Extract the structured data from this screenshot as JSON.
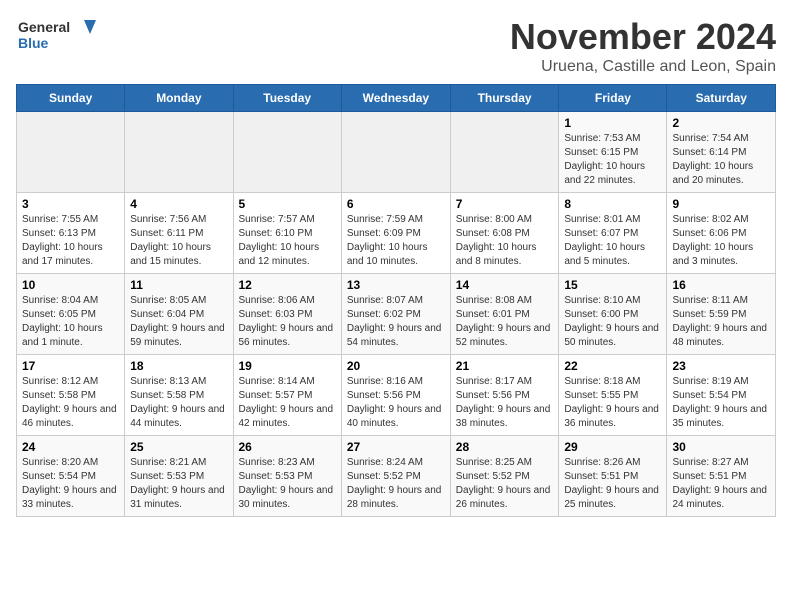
{
  "logo": {
    "line1": "General",
    "line2": "Blue"
  },
  "title": "November 2024",
  "subtitle": "Uruena, Castille and Leon, Spain",
  "weekdays": [
    "Sunday",
    "Monday",
    "Tuesday",
    "Wednesday",
    "Thursday",
    "Friday",
    "Saturday"
  ],
  "weeks": [
    [
      {
        "day": "",
        "info": ""
      },
      {
        "day": "",
        "info": ""
      },
      {
        "day": "",
        "info": ""
      },
      {
        "day": "",
        "info": ""
      },
      {
        "day": "",
        "info": ""
      },
      {
        "day": "1",
        "info": "Sunrise: 7:53 AM\nSunset: 6:15 PM\nDaylight: 10 hours and 22 minutes."
      },
      {
        "day": "2",
        "info": "Sunrise: 7:54 AM\nSunset: 6:14 PM\nDaylight: 10 hours and 20 minutes."
      }
    ],
    [
      {
        "day": "3",
        "info": "Sunrise: 7:55 AM\nSunset: 6:13 PM\nDaylight: 10 hours and 17 minutes."
      },
      {
        "day": "4",
        "info": "Sunrise: 7:56 AM\nSunset: 6:11 PM\nDaylight: 10 hours and 15 minutes."
      },
      {
        "day": "5",
        "info": "Sunrise: 7:57 AM\nSunset: 6:10 PM\nDaylight: 10 hours and 12 minutes."
      },
      {
        "day": "6",
        "info": "Sunrise: 7:59 AM\nSunset: 6:09 PM\nDaylight: 10 hours and 10 minutes."
      },
      {
        "day": "7",
        "info": "Sunrise: 8:00 AM\nSunset: 6:08 PM\nDaylight: 10 hours and 8 minutes."
      },
      {
        "day": "8",
        "info": "Sunrise: 8:01 AM\nSunset: 6:07 PM\nDaylight: 10 hours and 5 minutes."
      },
      {
        "day": "9",
        "info": "Sunrise: 8:02 AM\nSunset: 6:06 PM\nDaylight: 10 hours and 3 minutes."
      }
    ],
    [
      {
        "day": "10",
        "info": "Sunrise: 8:04 AM\nSunset: 6:05 PM\nDaylight: 10 hours and 1 minute."
      },
      {
        "day": "11",
        "info": "Sunrise: 8:05 AM\nSunset: 6:04 PM\nDaylight: 9 hours and 59 minutes."
      },
      {
        "day": "12",
        "info": "Sunrise: 8:06 AM\nSunset: 6:03 PM\nDaylight: 9 hours and 56 minutes."
      },
      {
        "day": "13",
        "info": "Sunrise: 8:07 AM\nSunset: 6:02 PM\nDaylight: 9 hours and 54 minutes."
      },
      {
        "day": "14",
        "info": "Sunrise: 8:08 AM\nSunset: 6:01 PM\nDaylight: 9 hours and 52 minutes."
      },
      {
        "day": "15",
        "info": "Sunrise: 8:10 AM\nSunset: 6:00 PM\nDaylight: 9 hours and 50 minutes."
      },
      {
        "day": "16",
        "info": "Sunrise: 8:11 AM\nSunset: 5:59 PM\nDaylight: 9 hours and 48 minutes."
      }
    ],
    [
      {
        "day": "17",
        "info": "Sunrise: 8:12 AM\nSunset: 5:58 PM\nDaylight: 9 hours and 46 minutes."
      },
      {
        "day": "18",
        "info": "Sunrise: 8:13 AM\nSunset: 5:58 PM\nDaylight: 9 hours and 44 minutes."
      },
      {
        "day": "19",
        "info": "Sunrise: 8:14 AM\nSunset: 5:57 PM\nDaylight: 9 hours and 42 minutes."
      },
      {
        "day": "20",
        "info": "Sunrise: 8:16 AM\nSunset: 5:56 PM\nDaylight: 9 hours and 40 minutes."
      },
      {
        "day": "21",
        "info": "Sunrise: 8:17 AM\nSunset: 5:56 PM\nDaylight: 9 hours and 38 minutes."
      },
      {
        "day": "22",
        "info": "Sunrise: 8:18 AM\nSunset: 5:55 PM\nDaylight: 9 hours and 36 minutes."
      },
      {
        "day": "23",
        "info": "Sunrise: 8:19 AM\nSunset: 5:54 PM\nDaylight: 9 hours and 35 minutes."
      }
    ],
    [
      {
        "day": "24",
        "info": "Sunrise: 8:20 AM\nSunset: 5:54 PM\nDaylight: 9 hours and 33 minutes."
      },
      {
        "day": "25",
        "info": "Sunrise: 8:21 AM\nSunset: 5:53 PM\nDaylight: 9 hours and 31 minutes."
      },
      {
        "day": "26",
        "info": "Sunrise: 8:23 AM\nSunset: 5:53 PM\nDaylight: 9 hours and 30 minutes."
      },
      {
        "day": "27",
        "info": "Sunrise: 8:24 AM\nSunset: 5:52 PM\nDaylight: 9 hours and 28 minutes."
      },
      {
        "day": "28",
        "info": "Sunrise: 8:25 AM\nSunset: 5:52 PM\nDaylight: 9 hours and 26 minutes."
      },
      {
        "day": "29",
        "info": "Sunrise: 8:26 AM\nSunset: 5:51 PM\nDaylight: 9 hours and 25 minutes."
      },
      {
        "day": "30",
        "info": "Sunrise: 8:27 AM\nSunset: 5:51 PM\nDaylight: 9 hours and 24 minutes."
      }
    ]
  ]
}
